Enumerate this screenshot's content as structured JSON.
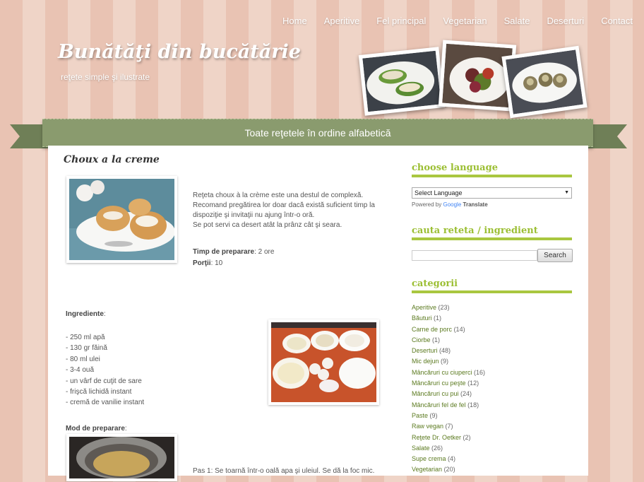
{
  "nav": [
    "Home",
    "Aperitive",
    "Fel principal",
    "Vegetarian",
    "Salate",
    "Deserturi",
    "Contact"
  ],
  "site": {
    "title": "Bunătăţi din bucătărie",
    "tagline": "reţete simple şi ilustrate"
  },
  "ribbon": {
    "label": "Toate reţetele în ordine alfabetică"
  },
  "post": {
    "title": "Choux a la creme",
    "intro": [
      "Reţeta choux à la crème este una destul de complexă.",
      "Recomand pregătirea lor doar dacă există suficient timp la",
      "dispoziţie şi invitaţii nu ajung într-o oră.",
      "Se pot servi ca desert atât la prânz cât şi seara."
    ],
    "prep_label": "Timp de preparare",
    "prep_value": "2 ore",
    "portions_label": "Porţii",
    "portions_value": "10",
    "ingredients_label": "Ingrediente",
    "ingredients": [
      "- 250 ml apă",
      "- 130 gr făină",
      "- 80 ml ulei",
      "- 3-4 ouă",
      "- un vârf de cuţit de sare",
      "- frişcă lichidă instant",
      "- cremă de vanilie instant"
    ],
    "method_label": "Mod de preparare",
    "step1": "Pas 1: Se toarnă într-o oală apa şi uleiul. Se dă la foc mic."
  },
  "sidebar": {
    "language_title": "choose language",
    "select_language": "Select Language",
    "powered_by": "Powered by",
    "google": "Google",
    "translate": "Translate",
    "search_title": "cauta reteta / ingredient",
    "search_button": "Search",
    "categories_title": "categorii",
    "categories": [
      {
        "name": "Aperitive",
        "count": "(23)"
      },
      {
        "name": "Băuturi",
        "count": "(1)"
      },
      {
        "name": "Carne de porc",
        "count": "(14)"
      },
      {
        "name": "Ciorbe",
        "count": "(1)"
      },
      {
        "name": "Deserturi",
        "count": "(48)"
      },
      {
        "name": "Mic dejun",
        "count": "(9)"
      },
      {
        "name": "Mâncăruri cu ciuperci",
        "count": "(16)"
      },
      {
        "name": "Mâncăruri cu peşte",
        "count": "(12)"
      },
      {
        "name": "Mâncăruri cu pui",
        "count": "(24)"
      },
      {
        "name": "Mâncăruri fel de fel",
        "count": "(18)"
      },
      {
        "name": "Paste",
        "count": "(9)"
      },
      {
        "name": "Raw vegan",
        "count": "(7)"
      },
      {
        "name": "Reţete Dr. Oetker",
        "count": "(2)"
      },
      {
        "name": "Salate",
        "count": "(26)"
      },
      {
        "name": "Supe crema",
        "count": "(4)"
      },
      {
        "name": "Vegetarian",
        "count": "(20)"
      }
    ]
  }
}
